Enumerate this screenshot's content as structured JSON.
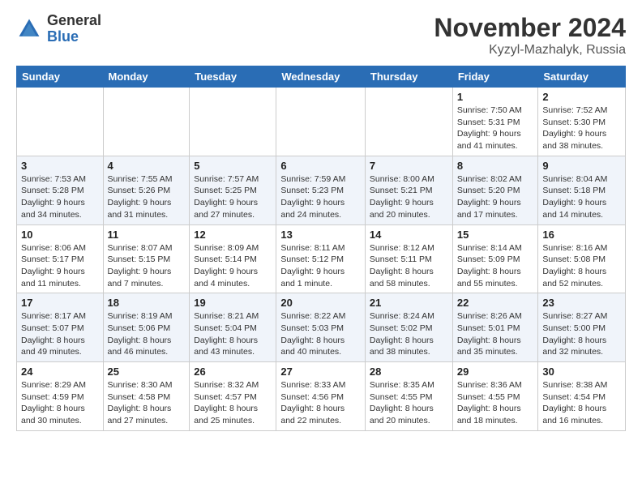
{
  "logo": {
    "general": "General",
    "blue": "Blue"
  },
  "header": {
    "month": "November 2024",
    "location": "Kyzyl-Mazhalyk, Russia"
  },
  "weekdays": [
    "Sunday",
    "Monday",
    "Tuesday",
    "Wednesday",
    "Thursday",
    "Friday",
    "Saturday"
  ],
  "weeks": [
    [
      {
        "day": "",
        "sunrise": "",
        "sunset": "",
        "daylight": ""
      },
      {
        "day": "",
        "sunrise": "",
        "sunset": "",
        "daylight": ""
      },
      {
        "day": "",
        "sunrise": "",
        "sunset": "",
        "daylight": ""
      },
      {
        "day": "",
        "sunrise": "",
        "sunset": "",
        "daylight": ""
      },
      {
        "day": "",
        "sunrise": "",
        "sunset": "",
        "daylight": ""
      },
      {
        "day": "1",
        "sunrise": "Sunrise: 7:50 AM",
        "sunset": "Sunset: 5:31 PM",
        "daylight": "Daylight: 9 hours and 41 minutes."
      },
      {
        "day": "2",
        "sunrise": "Sunrise: 7:52 AM",
        "sunset": "Sunset: 5:30 PM",
        "daylight": "Daylight: 9 hours and 38 minutes."
      }
    ],
    [
      {
        "day": "3",
        "sunrise": "Sunrise: 7:53 AM",
        "sunset": "Sunset: 5:28 PM",
        "daylight": "Daylight: 9 hours and 34 minutes."
      },
      {
        "day": "4",
        "sunrise": "Sunrise: 7:55 AM",
        "sunset": "Sunset: 5:26 PM",
        "daylight": "Daylight: 9 hours and 31 minutes."
      },
      {
        "day": "5",
        "sunrise": "Sunrise: 7:57 AM",
        "sunset": "Sunset: 5:25 PM",
        "daylight": "Daylight: 9 hours and 27 minutes."
      },
      {
        "day": "6",
        "sunrise": "Sunrise: 7:59 AM",
        "sunset": "Sunset: 5:23 PM",
        "daylight": "Daylight: 9 hours and 24 minutes."
      },
      {
        "day": "7",
        "sunrise": "Sunrise: 8:00 AM",
        "sunset": "Sunset: 5:21 PM",
        "daylight": "Daylight: 9 hours and 20 minutes."
      },
      {
        "day": "8",
        "sunrise": "Sunrise: 8:02 AM",
        "sunset": "Sunset: 5:20 PM",
        "daylight": "Daylight: 9 hours and 17 minutes."
      },
      {
        "day": "9",
        "sunrise": "Sunrise: 8:04 AM",
        "sunset": "Sunset: 5:18 PM",
        "daylight": "Daylight: 9 hours and 14 minutes."
      }
    ],
    [
      {
        "day": "10",
        "sunrise": "Sunrise: 8:06 AM",
        "sunset": "Sunset: 5:17 PM",
        "daylight": "Daylight: 9 hours and 11 minutes."
      },
      {
        "day": "11",
        "sunrise": "Sunrise: 8:07 AM",
        "sunset": "Sunset: 5:15 PM",
        "daylight": "Daylight: 9 hours and 7 minutes."
      },
      {
        "day": "12",
        "sunrise": "Sunrise: 8:09 AM",
        "sunset": "Sunset: 5:14 PM",
        "daylight": "Daylight: 9 hours and 4 minutes."
      },
      {
        "day": "13",
        "sunrise": "Sunrise: 8:11 AM",
        "sunset": "Sunset: 5:12 PM",
        "daylight": "Daylight: 9 hours and 1 minute."
      },
      {
        "day": "14",
        "sunrise": "Sunrise: 8:12 AM",
        "sunset": "Sunset: 5:11 PM",
        "daylight": "Daylight: 8 hours and 58 minutes."
      },
      {
        "day": "15",
        "sunrise": "Sunrise: 8:14 AM",
        "sunset": "Sunset: 5:09 PM",
        "daylight": "Daylight: 8 hours and 55 minutes."
      },
      {
        "day": "16",
        "sunrise": "Sunrise: 8:16 AM",
        "sunset": "Sunset: 5:08 PM",
        "daylight": "Daylight: 8 hours and 52 minutes."
      }
    ],
    [
      {
        "day": "17",
        "sunrise": "Sunrise: 8:17 AM",
        "sunset": "Sunset: 5:07 PM",
        "daylight": "Daylight: 8 hours and 49 minutes."
      },
      {
        "day": "18",
        "sunrise": "Sunrise: 8:19 AM",
        "sunset": "Sunset: 5:06 PM",
        "daylight": "Daylight: 8 hours and 46 minutes."
      },
      {
        "day": "19",
        "sunrise": "Sunrise: 8:21 AM",
        "sunset": "Sunset: 5:04 PM",
        "daylight": "Daylight: 8 hours and 43 minutes."
      },
      {
        "day": "20",
        "sunrise": "Sunrise: 8:22 AM",
        "sunset": "Sunset: 5:03 PM",
        "daylight": "Daylight: 8 hours and 40 minutes."
      },
      {
        "day": "21",
        "sunrise": "Sunrise: 8:24 AM",
        "sunset": "Sunset: 5:02 PM",
        "daylight": "Daylight: 8 hours and 38 minutes."
      },
      {
        "day": "22",
        "sunrise": "Sunrise: 8:26 AM",
        "sunset": "Sunset: 5:01 PM",
        "daylight": "Daylight: 8 hours and 35 minutes."
      },
      {
        "day": "23",
        "sunrise": "Sunrise: 8:27 AM",
        "sunset": "Sunset: 5:00 PM",
        "daylight": "Daylight: 8 hours and 32 minutes."
      }
    ],
    [
      {
        "day": "24",
        "sunrise": "Sunrise: 8:29 AM",
        "sunset": "Sunset: 4:59 PM",
        "daylight": "Daylight: 8 hours and 30 minutes."
      },
      {
        "day": "25",
        "sunrise": "Sunrise: 8:30 AM",
        "sunset": "Sunset: 4:58 PM",
        "daylight": "Daylight: 8 hours and 27 minutes."
      },
      {
        "day": "26",
        "sunrise": "Sunrise: 8:32 AM",
        "sunset": "Sunset: 4:57 PM",
        "daylight": "Daylight: 8 hours and 25 minutes."
      },
      {
        "day": "27",
        "sunrise": "Sunrise: 8:33 AM",
        "sunset": "Sunset: 4:56 PM",
        "daylight": "Daylight: 8 hours and 22 minutes."
      },
      {
        "day": "28",
        "sunrise": "Sunrise: 8:35 AM",
        "sunset": "Sunset: 4:55 PM",
        "daylight": "Daylight: 8 hours and 20 minutes."
      },
      {
        "day": "29",
        "sunrise": "Sunrise: 8:36 AM",
        "sunset": "Sunset: 4:55 PM",
        "daylight": "Daylight: 8 hours and 18 minutes."
      },
      {
        "day": "30",
        "sunrise": "Sunrise: 8:38 AM",
        "sunset": "Sunset: 4:54 PM",
        "daylight": "Daylight: 8 hours and 16 minutes."
      }
    ]
  ]
}
